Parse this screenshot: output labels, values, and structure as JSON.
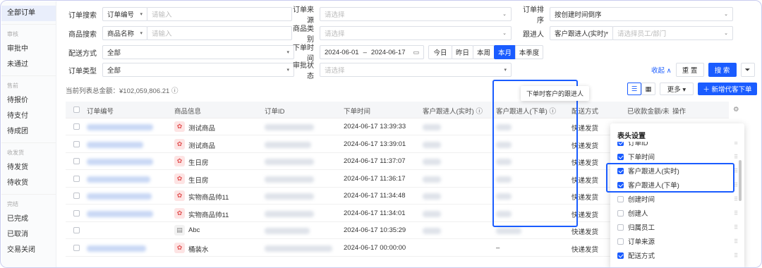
{
  "sidebar": {
    "all_orders": "全部订单",
    "groups": [
      {
        "title": "审核",
        "items": [
          "审批中",
          "未通过"
        ]
      },
      {
        "title": "售前",
        "items": [
          "待报价",
          "待支付",
          "待成团"
        ]
      },
      {
        "title": "收发货",
        "items": [
          "待发货",
          "待收货"
        ]
      },
      {
        "title": "完结",
        "items": [
          "已完成",
          "已取消",
          "交易关闭"
        ]
      }
    ]
  },
  "filters": {
    "order_search_label": "订单搜索",
    "order_search_type": "订单编号",
    "order_search_placeholder": "请输入",
    "order_source_label": "订单来源",
    "order_source_placeholder": "请选择",
    "order_sort_label": "订单排序",
    "order_sort_value": "按创建时间倒序",
    "product_search_label": "商品搜索",
    "product_search_type": "商品名称",
    "product_search_placeholder": "请输入",
    "product_category_label": "商品类别",
    "product_category_placeholder": "请选择",
    "follower_label": "跟进人",
    "follower_type": "客户跟进人(实时)",
    "follower_placeholder": "请选择员工/部门",
    "delivery_label": "配送方式",
    "delivery_value": "全部",
    "order_time_label": "下单时间",
    "date_start": "2024-06-01",
    "date_sep": "–",
    "date_end": "2024-06-17",
    "quick_dates": [
      "今日",
      "昨日",
      "本周",
      "本月",
      "本季度"
    ],
    "quick_active": "本月",
    "order_type_label": "订单类型",
    "order_type_value": "全部",
    "approval_label": "审批状态",
    "approval_placeholder": "请选择",
    "collapse_label": "收起 ∧",
    "reset_label": "重 置",
    "search_label": "搜 索"
  },
  "toolbar": {
    "total_label": "当前列表总金额：¥102,059,806.21 ⓘ",
    "more_label": "更多 ▾",
    "new_order_label": "＋ 新增代客下单",
    "tooltip": "下单时客户的跟进人"
  },
  "table": {
    "headers": [
      "订单编号",
      "商品信息",
      "订单ID",
      "下单时间",
      "客户跟进人(实时) ⓘ",
      "客户跟进人(下单) ⓘ",
      "配送方式",
      "已收款金额/未",
      "操作"
    ],
    "rows": [
      {
        "product": "测试商品",
        "time": "2024-06-17 13:39:33",
        "delivery": "快递发货",
        "icon": "gift"
      },
      {
        "product": "测试商品",
        "time": "2024-06-17 13:39:01",
        "delivery": "快递发货",
        "icon": "gift"
      },
      {
        "product": "生日房",
        "time": "2024-06-17 11:37:07",
        "delivery": "快递发货",
        "icon": "gift"
      },
      {
        "product": "生日房",
        "time": "2024-06-17 11:36:17",
        "delivery": "快递发货",
        "icon": "gift"
      },
      {
        "product": "实物商品帅11",
        "time": "2024-06-17 11:34:48",
        "delivery": "快递发货",
        "icon": "gift"
      },
      {
        "product": "实物商品帅11",
        "time": "2024-06-17 11:34:01",
        "delivery": "快递发货",
        "icon": "gift"
      },
      {
        "product": "Abc",
        "time": "2024-06-17 10:35:29",
        "delivery": "快递发货",
        "icon": "doc"
      },
      {
        "product": "桶装水",
        "time": "2024-06-17 00:00:00",
        "delivery": "快递发货",
        "icon": "gift",
        "follower_order": "–"
      }
    ]
  },
  "column_settings": {
    "title": "表头设置",
    "items": [
      {
        "label": "订单ID",
        "checked": true
      },
      {
        "label": "下单时间",
        "checked": true
      },
      {
        "label": "客户跟进人(实时)",
        "checked": true
      },
      {
        "label": "客户跟进人(下单)",
        "checked": true
      },
      {
        "label": "创建时间",
        "checked": false
      },
      {
        "label": "创建人",
        "checked": false
      },
      {
        "label": "归属员工",
        "checked": false
      },
      {
        "label": "订单来源",
        "checked": false
      },
      {
        "label": "配送方式",
        "checked": true
      }
    ]
  },
  "colors": {
    "accent": "#1a5cff",
    "highlight_border": "#1a5cff"
  }
}
